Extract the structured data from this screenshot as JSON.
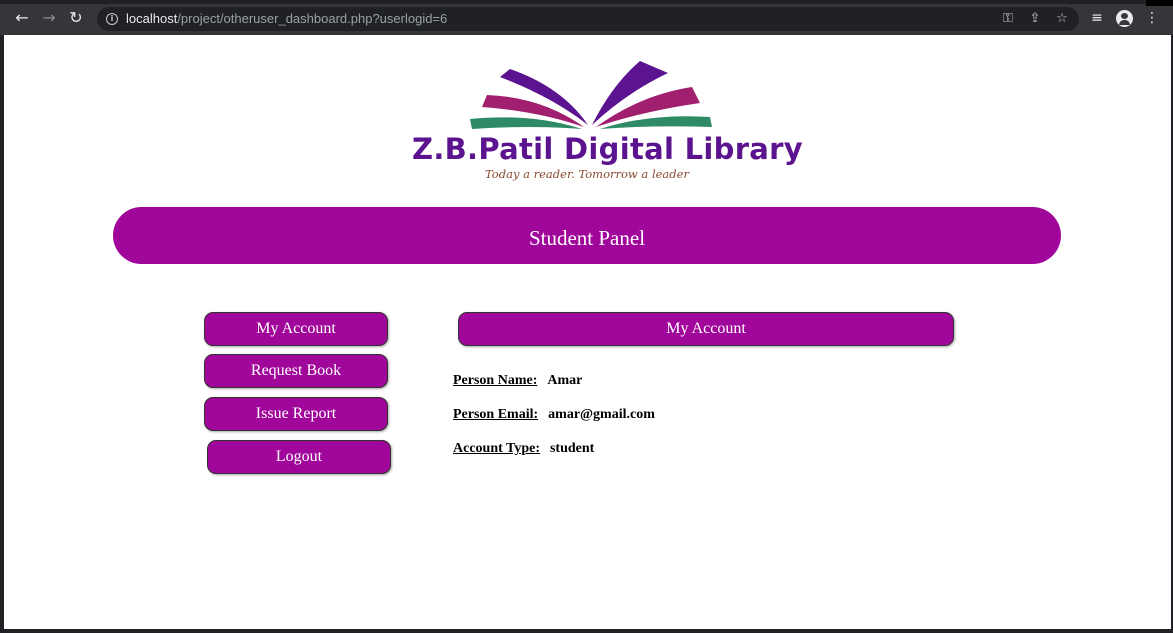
{
  "browser": {
    "url_host": "localhost",
    "url_path": "/project/otheruser_dashboard.php?userlogid=6",
    "icons": [
      "back-arrow-icon",
      "forward-arrow-icon",
      "reload-icon",
      "info-icon",
      "key-icon",
      "share-icon",
      "star-icon",
      "reading-list-icon",
      "profile-icon",
      "menu-dots-icon"
    ]
  },
  "logo": {
    "title": "Z.B.Patil Digital Library",
    "tagline": "Today a reader.  Tomorrow a leader",
    "colors": {
      "purple": "#5b138f",
      "magenta": "#a0206f",
      "green": "#2e8b66",
      "tagline": "#8a4a2f"
    }
  },
  "banner": {
    "title": "Student Panel",
    "color": "#a0069a"
  },
  "sidebar": {
    "items": [
      {
        "label": "My Account"
      },
      {
        "label": "Request Book"
      },
      {
        "label": "Issue Report"
      },
      {
        "label": "Logout"
      }
    ]
  },
  "main": {
    "section_title": "My Account",
    "fields": [
      {
        "label": "Person Name:",
        "value": "Amar"
      },
      {
        "label": "Person Email:",
        "value": "amar@gmail.com"
      },
      {
        "label": "Account Type:",
        "value": "student"
      }
    ]
  }
}
